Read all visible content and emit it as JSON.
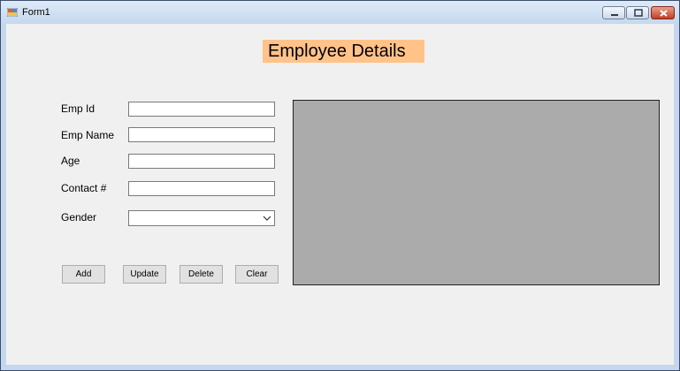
{
  "window": {
    "title": "Form1"
  },
  "heading": "Employee Details",
  "fields": {
    "emp_id": {
      "label": "Emp Id",
      "value": ""
    },
    "emp_name": {
      "label": "Emp Name",
      "value": ""
    },
    "age": {
      "label": "Age",
      "value": ""
    },
    "contact": {
      "label": "Contact #",
      "value": ""
    },
    "gender": {
      "label": "Gender",
      "value": ""
    }
  },
  "buttons": {
    "add": "Add",
    "update": "Update",
    "delete": "Delete",
    "clear": "Clear"
  },
  "colors": {
    "heading_bg": "#ffc38a",
    "grid_bg": "#ababab",
    "form_bg": "#f0f0f0"
  }
}
